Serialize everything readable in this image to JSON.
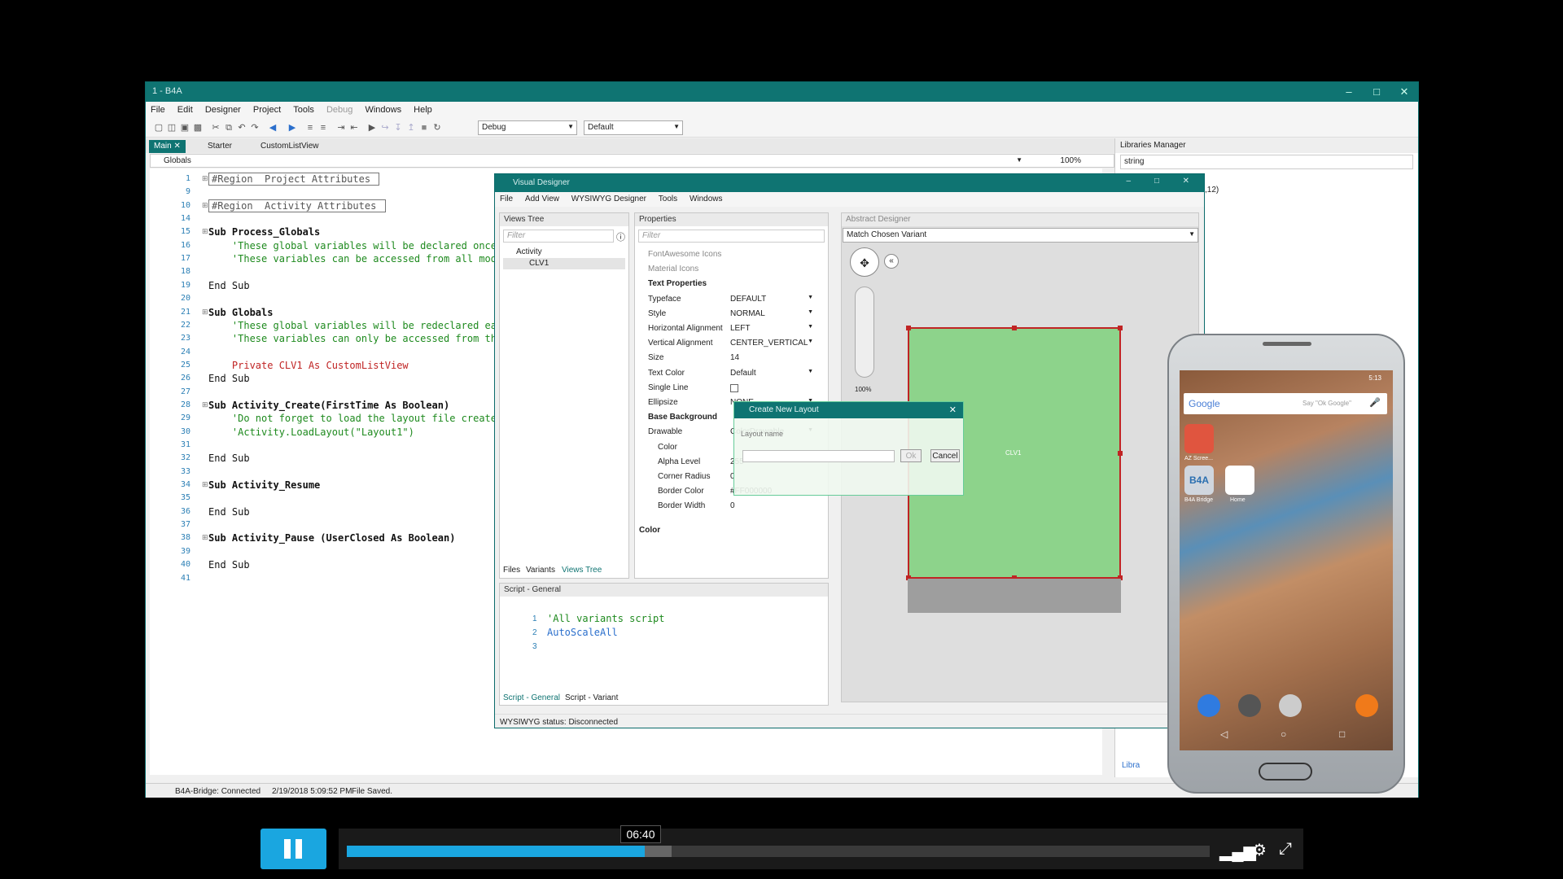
{
  "ide": {
    "title": "1 - B4A",
    "menu": [
      "File",
      "Edit",
      "Designer",
      "Project",
      "Tools",
      "Debug",
      "Windows",
      "Help"
    ],
    "build_mode": "Debug",
    "build_config": "Default",
    "tabs": [
      {
        "label": "Main",
        "active": true
      },
      {
        "label": "Starter",
        "active": false
      },
      {
        "label": "CustomListView",
        "active": false
      }
    ],
    "module_combo": "Globals",
    "zoom": "100%",
    "code_lines": [
      {
        "n": "1",
        "text": "#Region  Project Attributes ",
        "type": "region"
      },
      {
        "n": "9",
        "text": "",
        "type": "plain"
      },
      {
        "n": "10",
        "text": "#Region  Activity Attributes ",
        "type": "region"
      },
      {
        "n": "14",
        "text": "",
        "type": "plain"
      },
      {
        "n": "15",
        "text": "Sub Process_Globals",
        "type": "sub"
      },
      {
        "n": "16",
        "text": "    'These global variables will be declared once",
        "type": "comment"
      },
      {
        "n": "17",
        "text": "    'These variables can be accessed from all mod",
        "type": "comment"
      },
      {
        "n": "18",
        "text": "",
        "type": "plain"
      },
      {
        "n": "19",
        "text": "End Sub",
        "type": "plain"
      },
      {
        "n": "20",
        "text": "",
        "type": "plain"
      },
      {
        "n": "21",
        "text": "Sub Globals",
        "type": "sub"
      },
      {
        "n": "22",
        "text": "    'These global variables will be redeclared ea",
        "type": "comment"
      },
      {
        "n": "23",
        "text": "    'These variables can only be accessed from th",
        "type": "comment"
      },
      {
        "n": "24",
        "text": "",
        "type": "plain"
      },
      {
        "n": "25",
        "text": "    Private CLV1 As CustomListView",
        "type": "decl"
      },
      {
        "n": "26",
        "text": "End Sub",
        "type": "plain"
      },
      {
        "n": "27",
        "text": "",
        "type": "plain"
      },
      {
        "n": "28",
        "text": "Sub Activity_Create(FirstTime As Boolean)",
        "type": "sub"
      },
      {
        "n": "29",
        "text": "    'Do not forget to load the layout file create",
        "type": "comment"
      },
      {
        "n": "30",
        "text": "    'Activity.LoadLayout(\"Layout1\")",
        "type": "comment"
      },
      {
        "n": "31",
        "text": "",
        "type": "plain"
      },
      {
        "n": "32",
        "text": "End Sub",
        "type": "plain"
      },
      {
        "n": "33",
        "text": "",
        "type": "plain"
      },
      {
        "n": "34",
        "text": "Sub Activity_Resume",
        "type": "sub"
      },
      {
        "n": "35",
        "text": "",
        "type": "plain"
      },
      {
        "n": "36",
        "text": "End Sub",
        "type": "plain"
      },
      {
        "n": "37",
        "text": "",
        "type": "plain"
      },
      {
        "n": "38",
        "text": "Sub Activity_Pause (UserClosed As Boolean)",
        "type": "sub"
      },
      {
        "n": "39",
        "text": "",
        "type": "plain"
      },
      {
        "n": "40",
        "text": "End Sub",
        "type": "plain"
      },
      {
        "n": "41",
        "text": "",
        "type": "plain"
      }
    ],
    "libraries_manager": {
      "title": "Libraries Manager",
      "search": "string",
      "partial_text": ",12)",
      "bottom_tab": "Libra"
    },
    "status": {
      "bridge": "B4A-Bridge: Connected",
      "time": "2/19/2018 5:09:52 PM",
      "msg": "File Saved."
    }
  },
  "designer": {
    "title": "Visual Designer",
    "menu": [
      "File",
      "Add View",
      "WYSIWYG Designer",
      "Tools",
      "Windows"
    ],
    "views_tree": {
      "title": "Views Tree",
      "filter": "Filter",
      "items": [
        "Activity",
        "CLV1"
      ],
      "tabs": [
        "Files",
        "Variants",
        "Views Tree"
      ]
    },
    "properties": {
      "title": "Properties",
      "filter": "Filter",
      "rows": [
        {
          "k": "FontAwesome Icons",
          "v": "",
          "kind": "dim"
        },
        {
          "k": "Material Icons",
          "v": "",
          "kind": "dim"
        },
        {
          "k": "Text Properties",
          "v": "",
          "kind": "section"
        },
        {
          "k": "Typeface",
          "v": "DEFAULT",
          "kind": "dd"
        },
        {
          "k": "Style",
          "v": "NORMAL",
          "kind": "dd"
        },
        {
          "k": "Horizontal Alignment",
          "v": "LEFT",
          "kind": "dd"
        },
        {
          "k": "Vertical Alignment",
          "v": "CENTER_VERTICAL",
          "kind": "dd"
        },
        {
          "k": "Size",
          "v": "14",
          "kind": "plain"
        },
        {
          "k": "Text Color",
          "v": "Default",
          "kind": "dd"
        },
        {
          "k": "Single Line",
          "v": "",
          "kind": "check"
        },
        {
          "k": "Ellipsize",
          "v": "NONE",
          "kind": "dd"
        },
        {
          "k": "Base Background",
          "v": "",
          "kind": "section"
        },
        {
          "k": "Drawable",
          "v": "ColorDrawable",
          "kind": "dd"
        },
        {
          "k": "Color",
          "v": "",
          "kind": "sub"
        },
        {
          "k": "Alpha Level",
          "v": "255",
          "kind": "sub"
        },
        {
          "k": "Corner Radius",
          "v": "0",
          "kind": "sub"
        },
        {
          "k": "Border Color",
          "v": "#FF000000",
          "kind": "sub"
        },
        {
          "k": "Border Width",
          "v": "0",
          "kind": "sub"
        }
      ],
      "footer": "Color"
    },
    "abstract": {
      "title": "Abstract Designer",
      "variant": "Match Chosen Variant",
      "zoom": "100%",
      "view_label": "CLV1"
    },
    "script": {
      "title": "Script - General",
      "lines": [
        "'All variants script",
        "AutoScaleAll",
        ""
      ],
      "tabs": [
        "Script - General",
        "Script - Variant"
      ]
    },
    "status": "WYSIWYG status: Disconnected"
  },
  "dialog": {
    "title": "Create New Layout",
    "label": "Layout name",
    "value": "",
    "ok": "Ok",
    "cancel": "Cancel"
  },
  "phone": {
    "status_time": "5:13",
    "search_brand": "Google",
    "search_hint": "Say \"Ok Google\"",
    "apps": [
      "AZ Scree...",
      "B4A Bridge",
      "Home"
    ],
    "b4a_icon": "B4A"
  },
  "player": {
    "time": "06:40",
    "progress_pct": 34.5,
    "buffer_pct": 37.6
  }
}
